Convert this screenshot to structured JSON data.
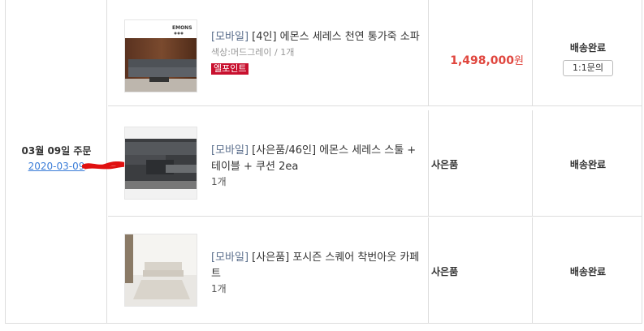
{
  "order": {
    "date_label": "03월 09일 주문",
    "order_number_visible": "2020-03-09"
  },
  "rows": [
    {
      "prefix": "[모바일]",
      "title": "[4인] 에몬스 세레스 천연 통가죽 소파",
      "option": "색상:머드그레이 / 1개",
      "badge": "엘포인트",
      "price": "1,498,000",
      "currency": "원",
      "status": "배송완료",
      "inquiry_label": "1:1문의",
      "brand_logo": "EMONS"
    },
    {
      "prefix": "[모바일]",
      "title": "[사은품/46인] 에몬스 세레스 스툴 + 테이블 + 쿠션 2ea",
      "qty": "1개",
      "gift_label": "사은품",
      "status": "배송완료"
    },
    {
      "prefix": "[모바일]",
      "title": "[사은품] 포시즌 스퀘어 착번아웃 카페트",
      "qty": "1개",
      "gift_label": "사은품",
      "status": "배송완료"
    }
  ],
  "colors": {
    "price": "#e0463e",
    "badge": "#c8102e",
    "link": "#3b7dd8",
    "border": "#dddddd"
  }
}
